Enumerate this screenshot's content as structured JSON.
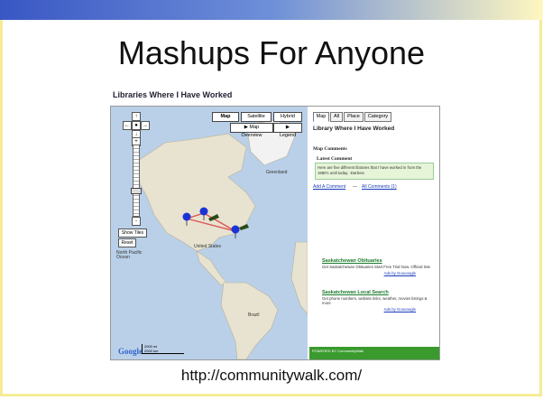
{
  "slide": {
    "title": "Mashups For Anyone",
    "url": "http://communitywalk.com/"
  },
  "screenshot": {
    "heading": "Libraries Where I Have Worked",
    "map": {
      "buttons": {
        "map": "Map",
        "satellite": "Satellite",
        "hybrid": "Hybrid",
        "overview": "Map Overview",
        "legend": "Legend"
      },
      "zoom_plus": "+",
      "zoom_minus": "-",
      "nav_up": "↑",
      "nav_left": "←",
      "nav_center": "●",
      "nav_right": "→",
      "nav_down": "↓",
      "show_tiles": "Show Tiles",
      "reset": "Reset",
      "labels": {
        "united_states": "United States",
        "greenland": "Greenland",
        "north_pacific": "North Pacific Ocean",
        "brazil": "Brazil"
      },
      "google_logo": "Google",
      "scale_top": "2000 mi",
      "scale_bottom": "2000 km"
    },
    "panel": {
      "tabs": [
        "Map",
        "All",
        "Place",
        "Category"
      ],
      "title": "Library Where I Have Worked",
      "map_comments": "Map Comments",
      "latest_comment": "Latest Comment",
      "comment_text": "Here are five different libraries that I have worked in from the 1980's until today.   -Darlene",
      "add_comment": "Add A Comment",
      "separator": "—",
      "all_comments": "All Comments (1)",
      "ads": [
        {
          "title": "Saskatchewan Obituaries",
          "body": "Get Saskatchewan Obituaries Start Free Trial Now. Official Site",
          "by": "Ads by Gooooogle"
        },
        {
          "title": "Saskatchewan Local Search",
          "body": "Get phone numbers, website links, weather, movies listings & more",
          "by": "Ads by Gooooogle"
        }
      ],
      "footer_text": "POWERED BY CommunityWalk"
    }
  }
}
